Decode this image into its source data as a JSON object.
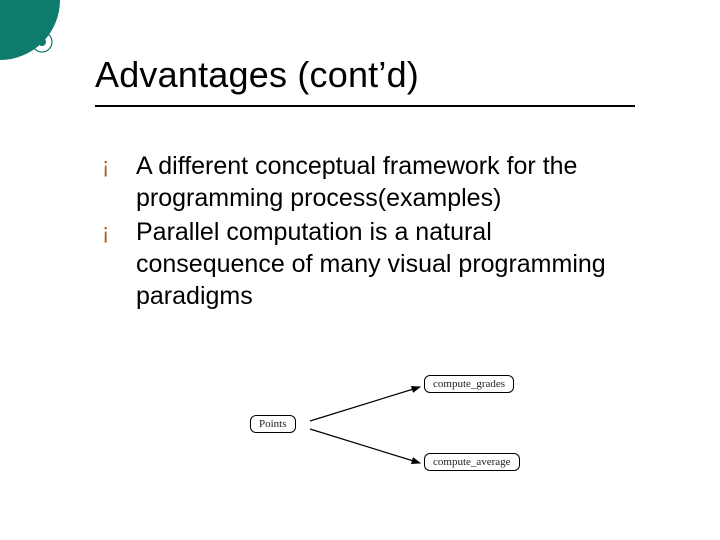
{
  "title": "Advantages (cont’d)",
  "bullets": [
    {
      "mark": "¡",
      "text": "A different conceptual framework for the programming process(examples)"
    },
    {
      "mark": "¡",
      "text": "Parallel computation is a natural consequence of many visual programming paradigms"
    }
  ],
  "diagram": {
    "left_node": "Points",
    "right_top_node": "compute_grades",
    "right_bottom_node": "compute_average"
  },
  "colors": {
    "accent_teal": "#0f7b6d",
    "bullet_orange": "#b45c17"
  }
}
